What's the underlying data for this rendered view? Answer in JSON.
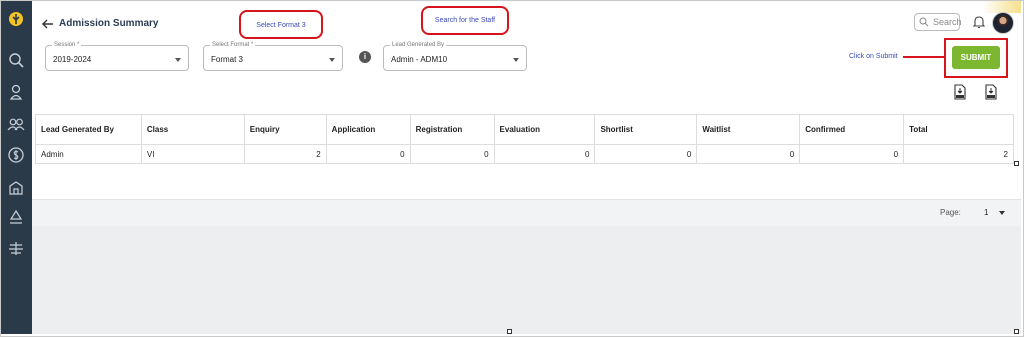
{
  "header": {
    "title": "Admission Summary",
    "search_label": "Search"
  },
  "filters": {
    "session": {
      "label": "Session *",
      "value": "2019-2024"
    },
    "format": {
      "label": "Select Format *",
      "value": "Format 3"
    },
    "lead": {
      "label": "Lead Generated By",
      "value": "Admin - ADM10"
    }
  },
  "annotations": {
    "select_format": "Select Format 3",
    "search_staff": "Search for the Staff",
    "click_submit": "Click on Submit"
  },
  "submit_label": "SUBMIT",
  "table": {
    "columns": [
      "Lead Generated By",
      "Class",
      "Enquiry",
      "Application",
      "Registration",
      "Evaluation",
      "Shortlist",
      "Waitlist",
      "Confirmed",
      "Total"
    ],
    "rows": [
      [
        "Admin",
        "VI",
        "2",
        "0",
        "0",
        "0",
        "0",
        "0",
        "0",
        "2"
      ]
    ]
  },
  "pager": {
    "label": "Page:",
    "value": "1"
  },
  "colors": {
    "sidebar": "#2b3a48",
    "submit": "#7cb82f",
    "callout": "#d6141b",
    "accent_text": "#3b4ab8"
  },
  "icons": {
    "sidebar": [
      "logo-icon",
      "search-icon",
      "student-icon",
      "users-icon",
      "dollar-icon",
      "building-icon",
      "recycle-icon",
      "stack-icon"
    ],
    "downloads": [
      "download-csv-icon",
      "download-pdf-icon"
    ]
  }
}
